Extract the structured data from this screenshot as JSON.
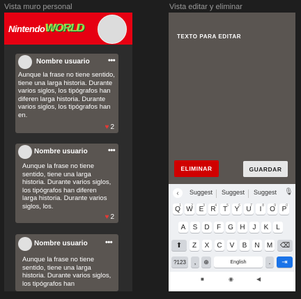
{
  "frames": {
    "left_label": "Vista muro personal",
    "right_label": "Vista editar y eliminar"
  },
  "banner": {
    "logo_part1": "Nintendo",
    "logo_part2": "WORLD",
    "background": "#e60012"
  },
  "posts": [
    {
      "username": "Nombre usuario",
      "menu": "•••",
      "text": "Aunque la frase no tiene sentido, tiene una larga historia. Durante varios siglos, los tipógrafos han diferen larga historia. Durante varios siglos, los tipógrafos han en.",
      "likes": "2"
    },
    {
      "username": "Nombre usuario",
      "menu": "•••",
      "text": "Aunque la frase no tiene sentido, tiene una larga historia. Durante varios siglos, los tipógrafos han diferen larga historia. Durante varios siglos, los.",
      "likes": "2"
    },
    {
      "username": "Nombre usuario",
      "menu": "•••",
      "text": "Aunque la frase no tiene sentido, tiene una larga historia. Durante varios siglos, los tipógrafos han",
      "likes": ""
    }
  ],
  "editor": {
    "placeholder": "TEXTO PARA EDITAR",
    "delete_label": "ELIMINAR",
    "save_label": "GUARDAR",
    "delete_color": "#d00000"
  },
  "keyboard": {
    "suggestions": [
      "Suggest",
      "Suggest",
      "Suggest"
    ],
    "row1": [
      "Q",
      "W",
      "E",
      "R",
      "T",
      "Y",
      "U",
      "I",
      "O",
      "P"
    ],
    "row1_alt": [
      "1",
      "2",
      "3",
      "4",
      "5",
      "6",
      "7",
      "8",
      "9",
      "0"
    ],
    "row2": [
      "A",
      "S",
      "D",
      "F",
      "G",
      "H",
      "J",
      "K",
      "L"
    ],
    "row3": [
      "Z",
      "X",
      "C",
      "V",
      "B",
      "N",
      "M"
    ],
    "symbols_key": "?123",
    "comma_key": ",",
    "space_label": "English",
    "period_key": "."
  }
}
